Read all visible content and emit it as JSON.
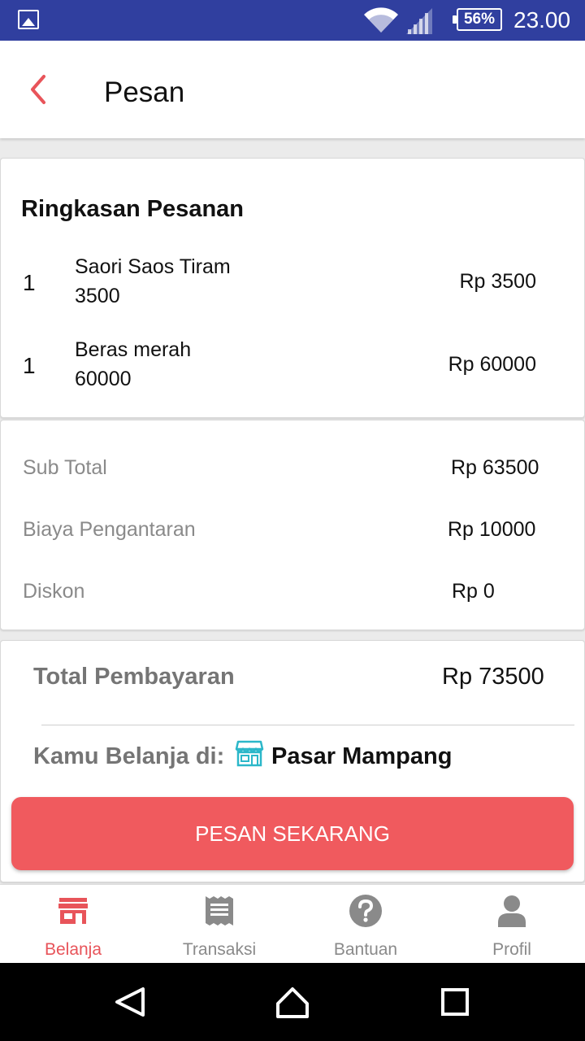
{
  "status_bar": {
    "battery": "56%",
    "time": "23.00"
  },
  "app_bar": {
    "title": "Pesan",
    "back_icon": "chevron-left-icon"
  },
  "summary": {
    "title": "Ringkasan Pesanan",
    "items": [
      {
        "qty": "1",
        "name": "Saori Saos Tiram",
        "unit_price": "3500",
        "total": "Rp 3500"
      },
      {
        "qty": "1",
        "name": "Beras merah",
        "unit_price": "60000",
        "total": "Rp 60000"
      }
    ]
  },
  "costs": {
    "subtotal_label": "Sub Total",
    "subtotal_value": "Rp 63500",
    "delivery_label": "Biaya Pengantaran",
    "delivery_value": "Rp 10000",
    "discount_label": "Diskon",
    "discount_value": "Rp 0"
  },
  "payment": {
    "total_label": "Total Pembayaran",
    "total_value": "Rp 73500",
    "shop_label": "Kamu Belanja di:",
    "shop_name": "Pasar Mampang",
    "shop_icon": "store-icon"
  },
  "order_button": "PESAN SEKARANG",
  "bottom_nav": [
    {
      "label": "Belanja",
      "icon": "store-icon",
      "active": true
    },
    {
      "label": "Transaksi",
      "icon": "receipt-icon",
      "active": false
    },
    {
      "label": "Bantuan",
      "icon": "help-icon",
      "active": false
    },
    {
      "label": "Profil",
      "icon": "person-icon",
      "active": false
    }
  ],
  "colors": {
    "status_bar": "#303f9f",
    "accent": "#f05a5e",
    "nav_active": "#e8545a",
    "shop_icon": "#2bb7c9"
  }
}
